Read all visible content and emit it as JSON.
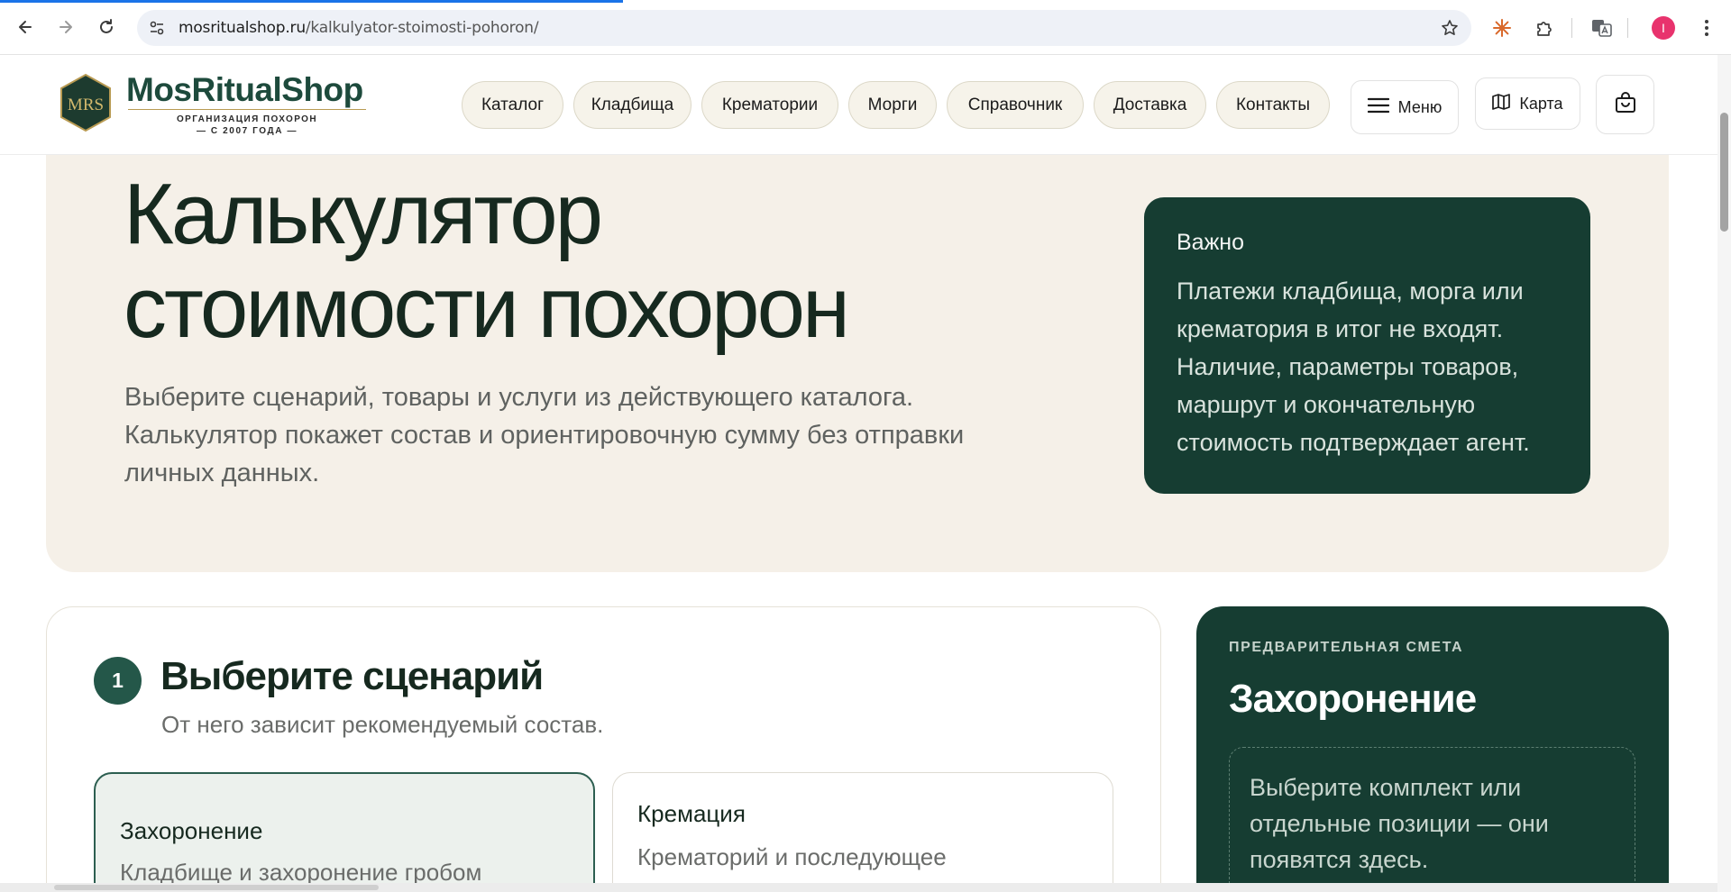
{
  "browser": {
    "url_host": "mosritualshop.ru",
    "url_path": "/kalkulyator-stoimosti-pohoron/",
    "profile_initial": "I",
    "load_progress": 0.36,
    "icons": [
      "back-arrow-icon",
      "forward-arrow-icon",
      "reload-icon",
      "site-settings-icon",
      "bookmark-star-icon",
      "extension-sunburst-icon",
      "extensions-puzzle-icon",
      "translate-icon",
      "kebab-menu-icon"
    ]
  },
  "header": {
    "logo_initials": "MRS",
    "logo_name": "MosRitualShop",
    "logo_tagline1": "ОРГАНИЗАЦИЯ ПОХОРОН",
    "logo_tagline2": "— С 2007 ГОДА —",
    "nav": [
      "Каталог",
      "Кладбища",
      "Крематории",
      "Морги",
      "Справочник",
      "Доставка",
      "Контакты"
    ],
    "menu_label": "Меню",
    "map_label": "Карта",
    "colors": {
      "brand_green": "#1d4a3c",
      "pill_bg": "#f6f3ea",
      "gold": "#b89a52"
    }
  },
  "hero": {
    "title_line1": "Калькулятор",
    "title_line2": "стоимости похорон",
    "desc_line1": "Выберите сценарий, товары и услуги из действующего каталога.",
    "desc_line2": "Калькулятор покажет состав и ориентировочную сумму без отправки",
    "desc_line3": "личных данных.",
    "note_title": "Важно",
    "note_lines": [
      "Платежи кладбища, морга или",
      "крематория в итог не входят.",
      "Наличие, параметры товаров,",
      "маршрут и окончательную",
      "стоимость подтверждает агент."
    ],
    "colors": {
      "hero_bg": "#f5f0e8",
      "dark_green": "#163d32"
    }
  },
  "step": {
    "number": "1",
    "title": "Выберите сценарий",
    "subtitle": "От него зависит рекомендуемый состав.",
    "options": [
      {
        "title": "Захоронение",
        "desc": "Кладбище и захоронение гробом",
        "selected": true
      },
      {
        "title": "Кремация",
        "desc": "Крематорий и последующее",
        "selected": false
      }
    ]
  },
  "estimate": {
    "label": "ПРЕДВАРИТЕЛЬНАЯ СМЕТА",
    "title": "Захоронение",
    "empty_lines": [
      "Выберите комплект или",
      "отдельные позиции — они",
      "появятся здесь."
    ]
  }
}
